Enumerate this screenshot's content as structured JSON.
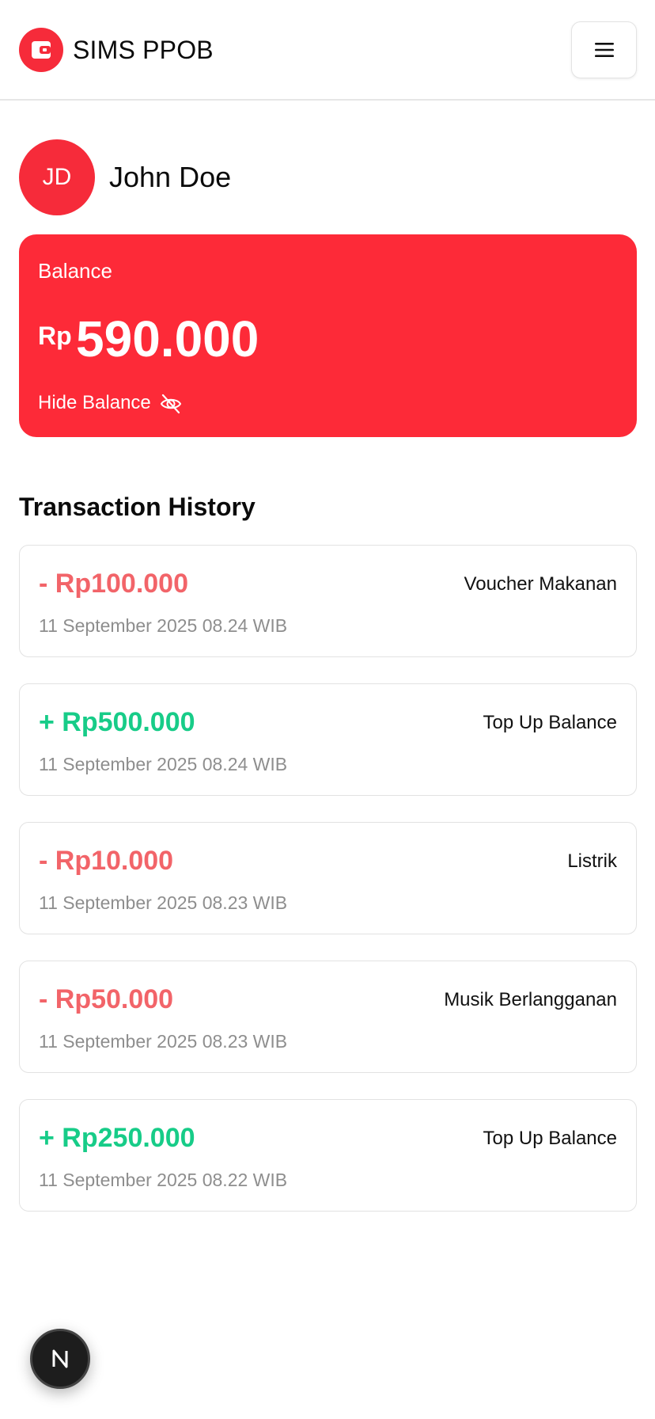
{
  "header": {
    "app_title": "SIMS PPOB",
    "logo_icon": "wallet-icon",
    "menu_icon": "hamburger-menu-icon"
  },
  "profile": {
    "initials": "JD",
    "name": "John Doe"
  },
  "balance": {
    "label": "Balance",
    "currency": "Rp",
    "amount": "590.000",
    "toggle_label": "Hide Balance",
    "toggle_icon": "eye-off-icon"
  },
  "history": {
    "title": "Transaction History",
    "items": [
      {
        "amount": "- Rp100.000",
        "type": "out",
        "description": "Voucher Makanan",
        "date": "11 September 2025 08.24 WIB"
      },
      {
        "amount": "+ Rp500.000",
        "type": "in",
        "description": "Top Up Balance",
        "date": "11 September 2025 08.24 WIB"
      },
      {
        "amount": "- Rp10.000",
        "type": "out",
        "description": "Listrik",
        "date": "11 September 2025 08.23 WIB"
      },
      {
        "amount": "- Rp50.000",
        "type": "out",
        "description": "Musik Berlangganan",
        "date": "11 September 2025 08.23 WIB"
      },
      {
        "amount": "+ Rp250.000",
        "type": "in",
        "description": "Top Up Balance",
        "date": "11 September 2025 08.22 WIB"
      }
    ]
  },
  "colors": {
    "brand_red": "#fd2a38",
    "expense": "#f26469",
    "income": "#17cc88",
    "muted_text": "#8e8e8e"
  },
  "dev_badge": {
    "letter": "N",
    "icon": "nextjs-icon"
  }
}
